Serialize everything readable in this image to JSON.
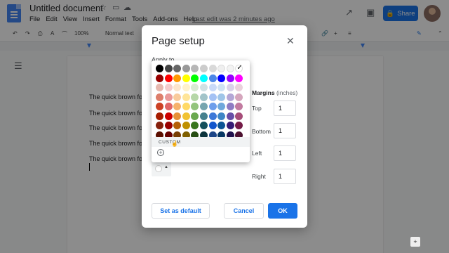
{
  "app": {
    "doc_title": "Untitled document",
    "menu": [
      "File",
      "Edit",
      "View",
      "Insert",
      "Format",
      "Tools",
      "Add-ons",
      "Help"
    ],
    "last_edit": "Last edit was 2 minutes ago",
    "share_label": "Share",
    "zoom": "100%",
    "style": "Normal text"
  },
  "document": {
    "lines": [
      "The quick brown fox",
      "The quick brown fox",
      "The quick brown fox",
      "The quick brown fox",
      "The quick brown fox"
    ]
  },
  "dialog": {
    "title": "Page setup",
    "apply_to_label": "Apply to",
    "margins_title": "Margins",
    "margins_unit": "(inches)",
    "margins": [
      {
        "label": "Top",
        "value": "1"
      },
      {
        "label": "Bottom",
        "value": "1"
      },
      {
        "label": "Left",
        "value": "1"
      },
      {
        "label": "Right",
        "value": "1"
      }
    ],
    "set_default_label": "Set as default",
    "cancel_label": "Cancel",
    "ok_label": "OK"
  },
  "palette": {
    "custom_label": "CUSTOM",
    "selected_color": "#ffffff",
    "rows": [
      [
        "#000000",
        "#434343",
        "#666666",
        "#999999",
        "#b7b7b7",
        "#cccccc",
        "#d9d9d9",
        "#efefef",
        "#f3f3f3",
        "#ffffff"
      ],
      [
        "#980000",
        "#ff0000",
        "#ff9900",
        "#ffff00",
        "#00ff00",
        "#00ffff",
        "#4a86e8",
        "#0000ff",
        "#9900ff",
        "#ff00ff"
      ],
      [
        "#e6b8af",
        "#f4cccc",
        "#fce5cd",
        "#fff2cc",
        "#d9ead3",
        "#d0e0e3",
        "#c9daf8",
        "#cfe2f3",
        "#d9d2e9",
        "#ead1dc"
      ],
      [
        "#dd7e6b",
        "#ea9999",
        "#f9cb9c",
        "#ffe599",
        "#b6d7a8",
        "#a2c4c9",
        "#a4c2f4",
        "#9fc5e8",
        "#b4a7d6",
        "#d5a6bd"
      ],
      [
        "#cc4125",
        "#e06666",
        "#f6b26b",
        "#ffd966",
        "#93c47d",
        "#76a5af",
        "#6d9eeb",
        "#6fa8dc",
        "#8e7cc3",
        "#c27ba0"
      ],
      [
        "#a61c00",
        "#cc0000",
        "#e69138",
        "#f1c232",
        "#6aa84f",
        "#45818e",
        "#3c78d8",
        "#3d85c6",
        "#674ea7",
        "#a64d79"
      ],
      [
        "#85200c",
        "#990000",
        "#b45f06",
        "#bf9000",
        "#38761d",
        "#134f5c",
        "#1155cc",
        "#0b5394",
        "#351c75",
        "#741b47"
      ],
      [
        "#5b0f00",
        "#660000",
        "#783f04",
        "#7f6000",
        "#274e13",
        "#0c343d",
        "#1c4587",
        "#073763",
        "#20124d",
        "#4c1130"
      ]
    ]
  }
}
